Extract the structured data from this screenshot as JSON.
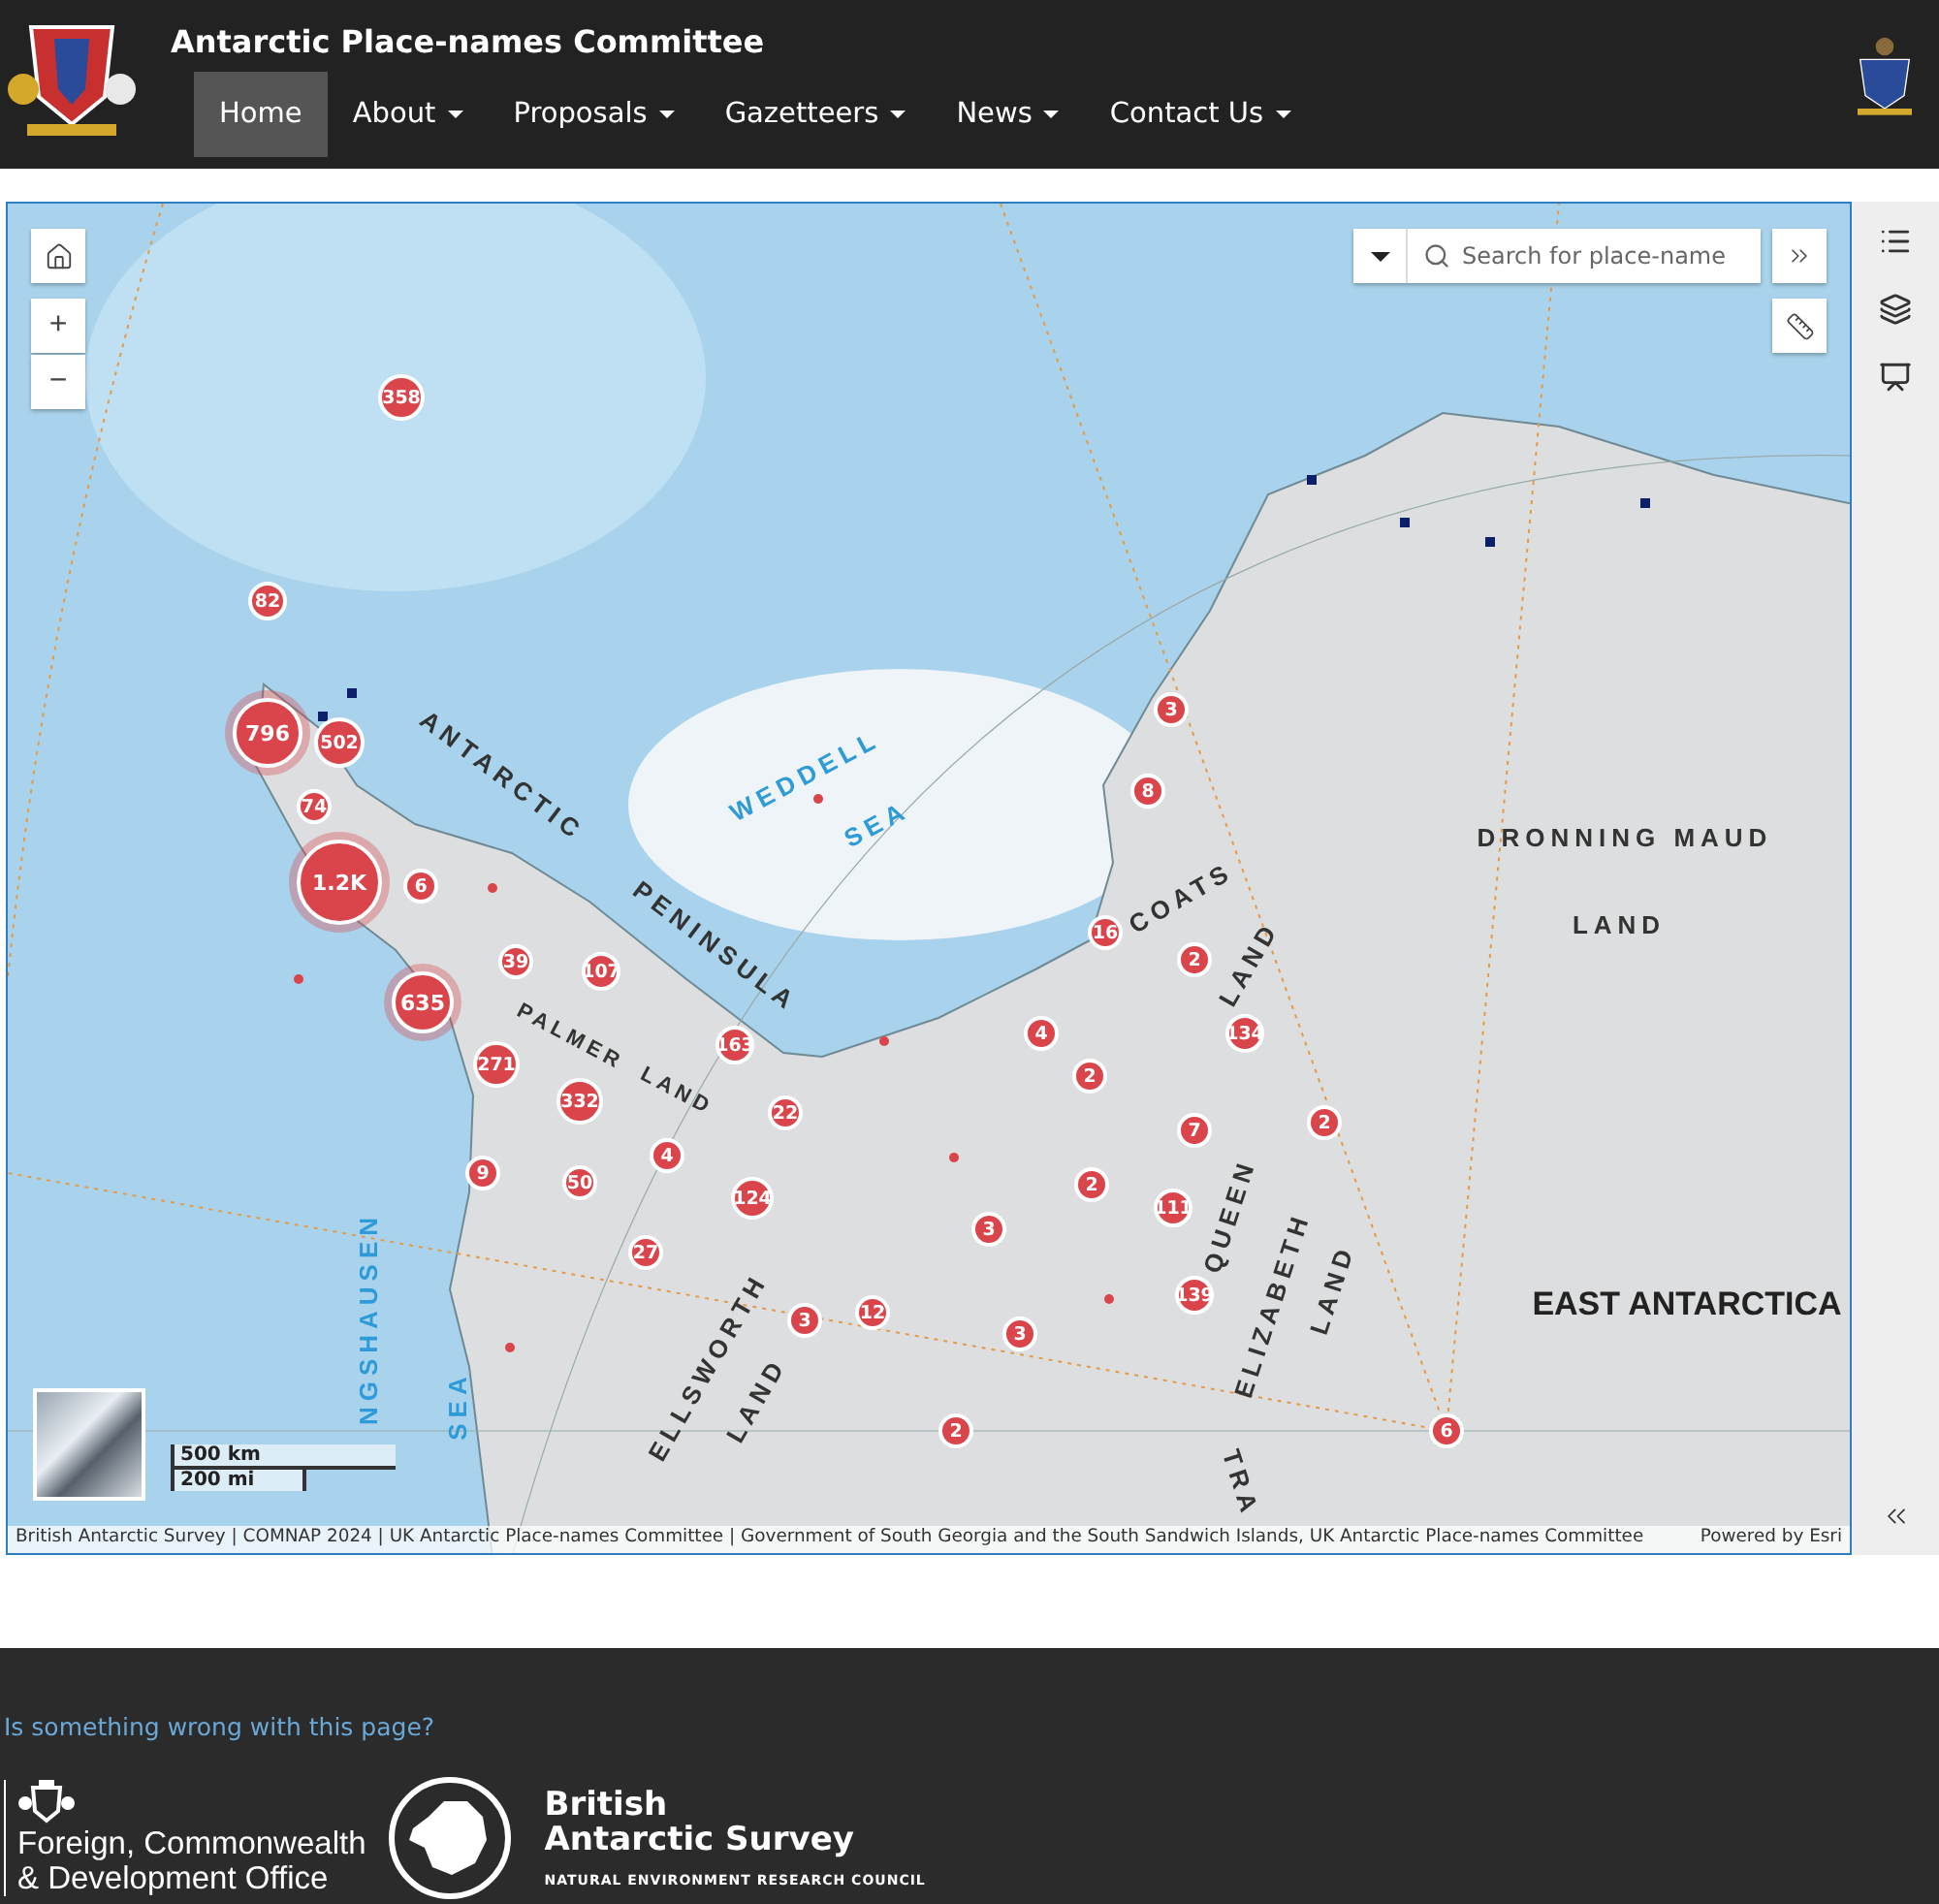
{
  "header": {
    "title": "Antarctic Place-names Committee",
    "nav": [
      {
        "label": "Home",
        "selected": true,
        "dropdown": false
      },
      {
        "label": "About",
        "selected": false,
        "dropdown": true
      },
      {
        "label": "Proposals",
        "selected": false,
        "dropdown": true
      },
      {
        "label": "Gazetteers",
        "selected": false,
        "dropdown": true
      },
      {
        "label": "News",
        "selected": false,
        "dropdown": true
      },
      {
        "label": "Contact Us",
        "selected": false,
        "dropdown": true
      }
    ]
  },
  "map": {
    "zoom": [
      "+",
      "−"
    ],
    "search": {
      "placeholder": "Search for place-name"
    },
    "scale": [
      "500 km",
      "200 mi"
    ],
    "labels": [
      {
        "text": "ANTARCTIC",
        "kind": "land"
      },
      {
        "text": "PENINSULA",
        "kind": "land"
      },
      {
        "text": "WEDDELL",
        "kind": "sea"
      },
      {
        "text": "SEA",
        "kind": "sea"
      },
      {
        "text": "DRONNING MAUD",
        "kind": "land"
      },
      {
        "text": "LAND",
        "kind": "land"
      },
      {
        "text": "COATS",
        "kind": "land"
      },
      {
        "text": "LAND",
        "kind": "land"
      },
      {
        "text": "PALMER",
        "kind": "land"
      },
      {
        "text": "LAND",
        "kind": "land"
      },
      {
        "text": "QUEEN",
        "kind": "land"
      },
      {
        "text": "ELIZABETH",
        "kind": "land"
      },
      {
        "text": "LAND",
        "kind": "land"
      },
      {
        "text": "EAST ANTARCTICA",
        "kind": "region"
      },
      {
        "text": "ELLSWORTH",
        "kind": "land"
      },
      {
        "text": "LAND",
        "kind": "land"
      },
      {
        "text": "NGSHAUSEN",
        "kind": "sea"
      },
      {
        "text": "SEA",
        "kind": "sea"
      },
      {
        "text": "TRA",
        "kind": "land"
      }
    ],
    "clusters": [
      {
        "count": "358"
      },
      {
        "count": "82"
      },
      {
        "count": "796"
      },
      {
        "count": "502"
      },
      {
        "count": "74"
      },
      {
        "count": "1.2K"
      },
      {
        "count": "6"
      },
      {
        "count": "39"
      },
      {
        "count": "107"
      },
      {
        "count": "635"
      },
      {
        "count": "163"
      },
      {
        "count": "271"
      },
      {
        "count": "332"
      },
      {
        "count": "22"
      },
      {
        "count": "4"
      },
      {
        "count": "9"
      },
      {
        "count": "50"
      },
      {
        "count": "124"
      },
      {
        "count": "27"
      },
      {
        "count": "3"
      },
      {
        "count": "8"
      },
      {
        "count": "16"
      },
      {
        "count": "2"
      },
      {
        "count": "134"
      },
      {
        "count": "4"
      },
      {
        "count": "2"
      },
      {
        "count": "2"
      },
      {
        "count": "7"
      },
      {
        "count": "2"
      },
      {
        "count": "111"
      },
      {
        "count": "3"
      },
      {
        "count": "139"
      },
      {
        "count": "12"
      },
      {
        "count": "3"
      },
      {
        "count": "3"
      },
      {
        "count": "2"
      },
      {
        "count": "6"
      }
    ],
    "attribution": "British Antarctic Survey | COMNAP 2024 | UK Antarctic Place-names Committee | Government of South Georgia and the South Sandwich Islands, UK Antarctic Place-names Committee",
    "powered_by": "Powered by Esri"
  },
  "footer": {
    "link": "Is something wrong with this page?",
    "fcdo": [
      "Foreign, Commonwealth",
      "& Development Office"
    ],
    "bas": [
      "British",
      "Antarctic Survey"
    ],
    "council": "NATURAL ENVIRONMENT RESEARCH COUNCIL"
  }
}
